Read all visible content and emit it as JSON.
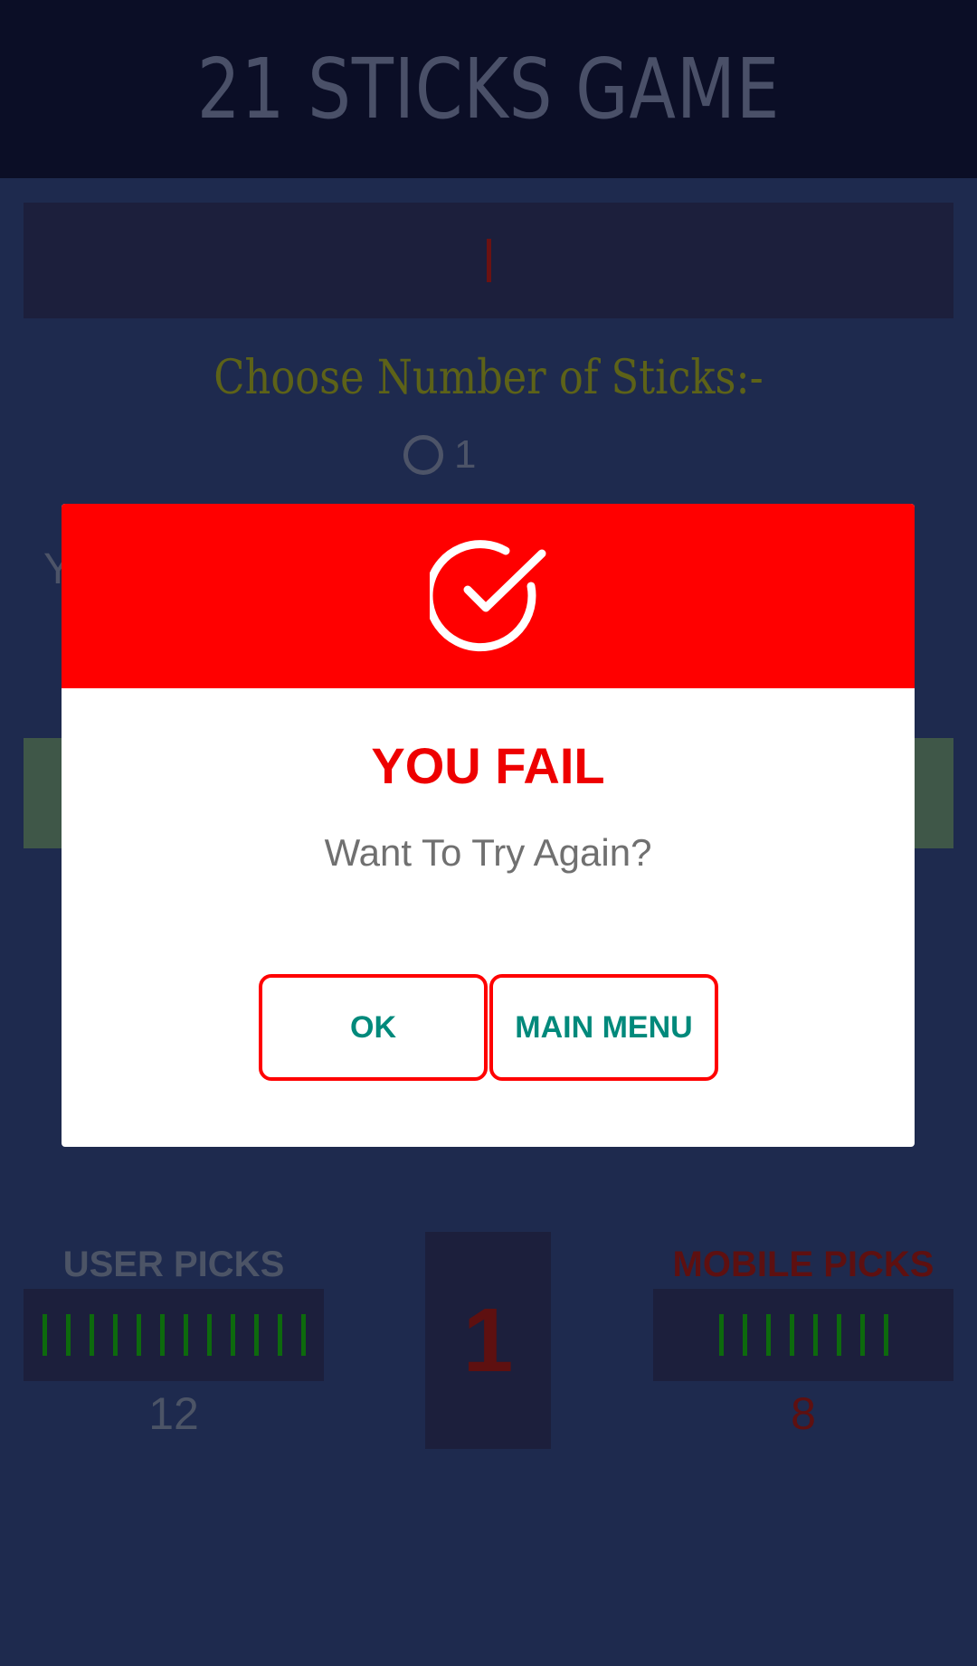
{
  "app": {
    "title": "21 STICKS GAME"
  },
  "game": {
    "choose_label": "Choose Number of Sticks:-",
    "radio_option": "1",
    "partial_text": "Y"
  },
  "score": {
    "user_label": "USER PICKS",
    "user_count": "12",
    "user_sticks": 12,
    "mobile_label": "MOBILE PICKS",
    "mobile_count": "8",
    "mobile_sticks": 8,
    "remaining": "1"
  },
  "dialog": {
    "icon": "check-circle-icon",
    "title": "YOU FAIL",
    "message": "Want To Try Again?",
    "ok_label": "OK",
    "menu_label": "MAIN MENU"
  },
  "colors": {
    "header_red": "#ff0000",
    "button_text": "#00897b",
    "background": "#1e2a4e"
  }
}
